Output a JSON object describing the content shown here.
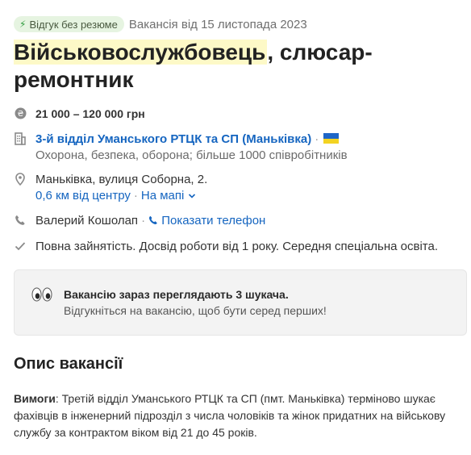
{
  "badge": {
    "label": "Відгук без резюме"
  },
  "posted": "Вакансія від 15 листопада 2023",
  "title": {
    "part1": "Військовослужбовець",
    "part2": ", слюсар-ремонтник"
  },
  "salary": "21 000 – 120 000 грн",
  "company": {
    "name": "3-й відділ Уманського РТЦК та СП (Маньківка)",
    "info": "Охорона, безпека, оборона; більше 1000 співробітників"
  },
  "location": {
    "address": "Маньківка, вулиця Соборна, 2.",
    "distance": "0,6 км від центру",
    "map_link": "На мапі"
  },
  "contact": {
    "name": "Валерий Кошолап",
    "phone_link": "Показати телефон"
  },
  "conditions": "Повна зайнятість. Досвід роботи від 1 року. Середня спеціальна освіта.",
  "notice": {
    "title": "Вакансію зараз переглядають 3 шукача.",
    "text": "Відгукніться на вакансію, щоб бути серед перших!"
  },
  "description": {
    "heading": "Опис вакансії",
    "label": "Вимоги",
    "text": ": Третій відділ Уманського РТЦК та СП (пмт. Маньківка) терміново шукає фахівців в інженерний підрозділ з числа чоловіків та жінок придатних на військову службу за контрактом віком від 21 до 45 років."
  },
  "colors": {
    "link": "#1565c0",
    "badge_bg": "#e6f4e1",
    "highlight": "#fdf9c7",
    "flag_blue": "#1f66c7",
    "flag_yellow": "#f3d321"
  },
  "icons": [
    "bolt-icon",
    "hryvnia-icon",
    "building-icon",
    "location-pin-icon",
    "phone-icon",
    "check-icon",
    "eyes-icon",
    "chevron-down-icon",
    "phone-link-icon",
    "ukraine-flag-icon"
  ]
}
